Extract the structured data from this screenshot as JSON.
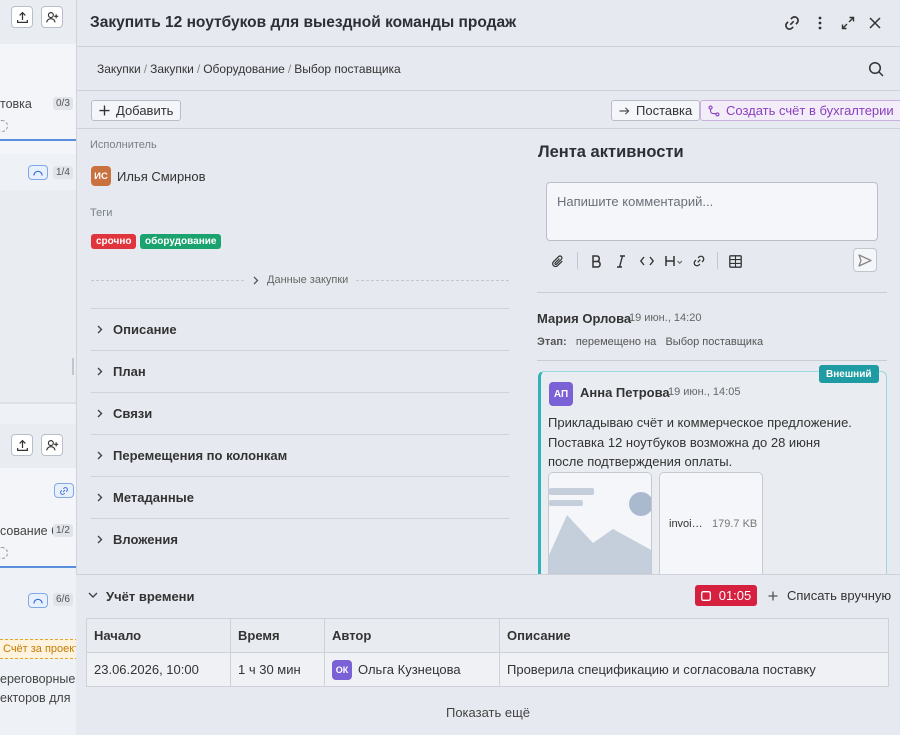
{
  "background": {
    "items": [
      {
        "text": "товка",
        "count": "0/3"
      },
      {
        "count": "1/4"
      },
      {
        "text": "сование б",
        "count": "1/2"
      },
      {
        "count": "6/6"
      },
      {
        "tag": "Счёт за проект"
      },
      {
        "text": "ереговорные о"
      },
      {
        "text": "екторов для"
      }
    ]
  },
  "modal": {
    "title": "Закупить 12 ноутбуков для выездной команды продаж",
    "breadcrumb": [
      "Закупки",
      "Закупки",
      "Оборудование",
      "Выбор поставщика"
    ],
    "toolbar": {
      "add_label": "Добавить",
      "delivery_label": "Поставка",
      "invoice_label": "Создать счёт в бухгалтерии"
    },
    "assignee": {
      "label": "Исполнитель",
      "initials": "ИС",
      "name": "Илья Смирнов",
      "color": "#c9713f"
    },
    "tags": {
      "label": "Теги",
      "items": [
        {
          "text": "срочно",
          "color": "#e0353d"
        },
        {
          "text": "оборудование",
          "color": "#1aa36e"
        }
      ]
    },
    "purchase_data_label": "Данные закупки",
    "sections": [
      "Описание",
      "План",
      "Связи",
      "Перемещения по колонкам",
      "Метаданные",
      "Вложения"
    ],
    "feed": {
      "title": "Лента активности",
      "comment_placeholder": "Напишите комментарий...",
      "event": {
        "author": "Мария Орлова",
        "time": "19 июн., 14:20",
        "stage_label": "Этап:",
        "action": "перемещено на",
        "target": "Выбор поставщика"
      },
      "comment": {
        "badge": "Внешний",
        "initials": "АП",
        "author": "Анна Петрова",
        "time": "19 июн., 14:05",
        "text": "Прикладываю счёт и коммерческое предложение. Поставка 12 ноутбуков возможна до 28 июня после подтверждения оплаты.",
        "attachments": [
          {
            "kind": "image"
          },
          {
            "kind": "file",
            "name": "invoi…",
            "size": "179.7 KB"
          }
        ]
      }
    },
    "time_tracking": {
      "title": "Учёт времени",
      "timer": "01:05",
      "manual_label": "Списать вручную",
      "columns": [
        "Начало",
        "Время",
        "Автор",
        "Описание"
      ],
      "rows": [
        {
          "start": "23.06.2026, 10:00",
          "duration": "1 ч 30 мин",
          "author_initials": "ОК",
          "author": "Ольга Кузнецова",
          "description": "Проверила спецификацию и согласовала поставку"
        }
      ],
      "show_more": "Показать ещё"
    }
  },
  "colors": {
    "accent_purple": "#8a3fbe",
    "external_badge": "#1f9ca3",
    "timer_red": "#d6203f",
    "avatar_purple": "#7b61d6"
  }
}
